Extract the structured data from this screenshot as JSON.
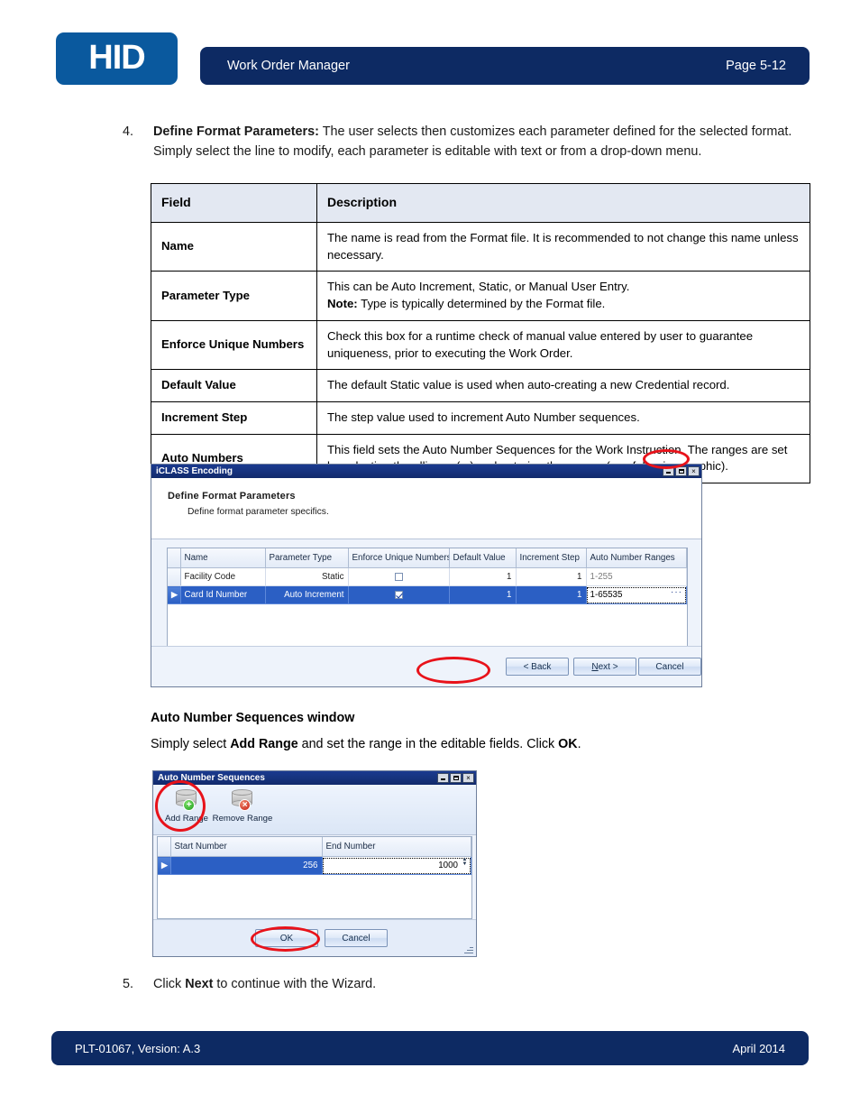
{
  "header": {
    "logo_text": "HID",
    "title": "Work Order Manager",
    "page": "Page 5-12"
  },
  "steps": [
    {
      "number": "4.",
      "lead": "Define Format Parameters:",
      "text": " The user selects then customizes each parameter defined for the selected format. Simply select the line to modify, each parameter is editable with text or from a drop-down menu."
    },
    {
      "number": "5.",
      "pre": "Click ",
      "lead": "Next",
      "text": " to continue with the Wizard."
    }
  ],
  "field_table": {
    "headers": [
      "Field",
      "Description"
    ],
    "rows": [
      {
        "field": "Name",
        "description": "The name is read from the Format file. It is recommended to not change this name unless necessary."
      },
      {
        "field": "Parameter Type",
        "description_line1": "This can be Auto Increment, Static, or Manual User Entry.",
        "description_note_label": "Note:",
        "description_note": " Type is typically determined by the Format file."
      },
      {
        "field": "Enforce Unique Numbers",
        "description": "Check this box for a runtime check of manual value entered by user to guarantee uniqueness, prior to executing the Work Order."
      },
      {
        "field": "Default Value",
        "description": "The default Static value is used when auto-creating a new Credential record."
      },
      {
        "field": "Increment Step",
        "description": "The step value used to increment Auto Number sequences."
      },
      {
        "field": "Auto Numbers",
        "description": "This field sets the Auto Number Sequences for the Work Instruction. The ranges are set by selecting the ellipses (...) and entering the ranges (see following graphic)."
      }
    ]
  },
  "iclass_dialog": {
    "title": "iCLASS Encoding",
    "heading": "Define Format Parameters",
    "subheading": "Define format parameter specifics.",
    "grid": {
      "columns": [
        "Name",
        "Parameter Type",
        "Enforce Unique Numbers",
        "Default Value",
        "Increment Step",
        "Auto Number Ranges"
      ],
      "rows": [
        {
          "selector": "",
          "name": "Facility Code",
          "parameter_type": "Static",
          "enforce_unique": false,
          "default_value": "1",
          "increment_step": "1",
          "auto_number_ranges": "1-255",
          "selected": false
        },
        {
          "selector": "▶",
          "name": "Card Id Number",
          "parameter_type": "Auto Increment",
          "enforce_unique": true,
          "default_value": "1",
          "increment_step": "1",
          "auto_number_ranges": "1-65535",
          "ellipsis": "···",
          "selected": true
        }
      ]
    },
    "buttons": {
      "back": "< Back",
      "next_pre": "N",
      "next_post": "ext >",
      "cancel": "Cancel"
    },
    "window_controls": {
      "minimize": "minimize-icon",
      "maximize": "maximize-icon",
      "close": "×"
    }
  },
  "caption": {
    "heading": "Auto Number Sequences window",
    "pre": "Simply select ",
    "bold1": "Add Range",
    "mid": " and set the range in the editable fields. Click ",
    "bold2": "OK",
    "post": "."
  },
  "ans_dialog": {
    "title": "Auto Number Sequences",
    "toolbar": [
      {
        "label": "Add Range",
        "icon": "database-add-icon",
        "badge": "+"
      },
      {
        "label": "Remove Range",
        "icon": "database-remove-icon",
        "badge": "×"
      }
    ],
    "grid": {
      "columns": [
        "Start Number",
        "End Number"
      ],
      "rows": [
        {
          "selector": "▶",
          "start_number": "256",
          "end_number": "1000",
          "selected": true
        }
      ]
    },
    "buttons": {
      "ok": "OK",
      "cancel": "Cancel"
    },
    "window_controls": {
      "minimize": "minimize-icon",
      "maximize": "maximize-icon",
      "close": "×"
    }
  },
  "highlight_color": "#e8121a",
  "footer": {
    "left": "PLT-01067, Version: A.3",
    "right": "April 2014"
  }
}
